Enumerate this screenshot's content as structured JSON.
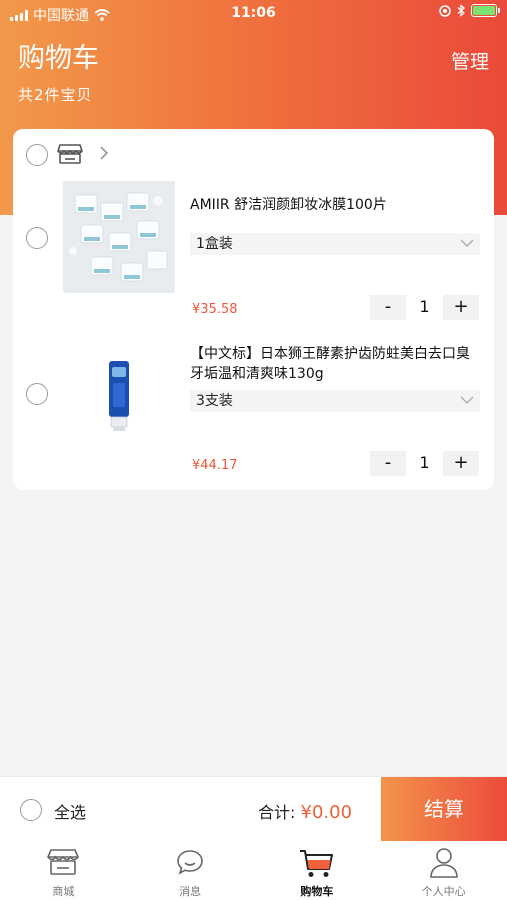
{
  "status_bar": {
    "carrier": "中国联通",
    "time": "11:06"
  },
  "header": {
    "title": "购物车",
    "count_text": "共2件宝贝",
    "manage_label": "管理"
  },
  "products": [
    {
      "name": "AMIIR 舒洁润颜卸妆冰膜100片",
      "variant": "1盒装",
      "price": "¥35.58",
      "quantity": "1",
      "minus": "-",
      "plus": "+"
    },
    {
      "name": "【中文标】日本狮王酵素护齿防蛀美白去口臭牙垢温和清爽味130g",
      "variant": "3支装",
      "price": "¥44.17",
      "quantity": "1",
      "minus": "-",
      "plus": "+"
    }
  ],
  "footer": {
    "select_all_label": "全选",
    "total_label": "合计:",
    "total_value": "¥0.00",
    "checkout_label": "结算"
  },
  "tabs": [
    {
      "label": "商城",
      "icon": "store-icon"
    },
    {
      "label": "消息",
      "icon": "message-icon"
    },
    {
      "label": "购物车",
      "icon": "cart-icon",
      "active": true
    },
    {
      "label": "个人中心",
      "icon": "person-icon"
    }
  ],
  "colors": {
    "accent": "#f0603a",
    "gradient_start": "#f2994a",
    "gradient_end": "#ea4a3a"
  }
}
